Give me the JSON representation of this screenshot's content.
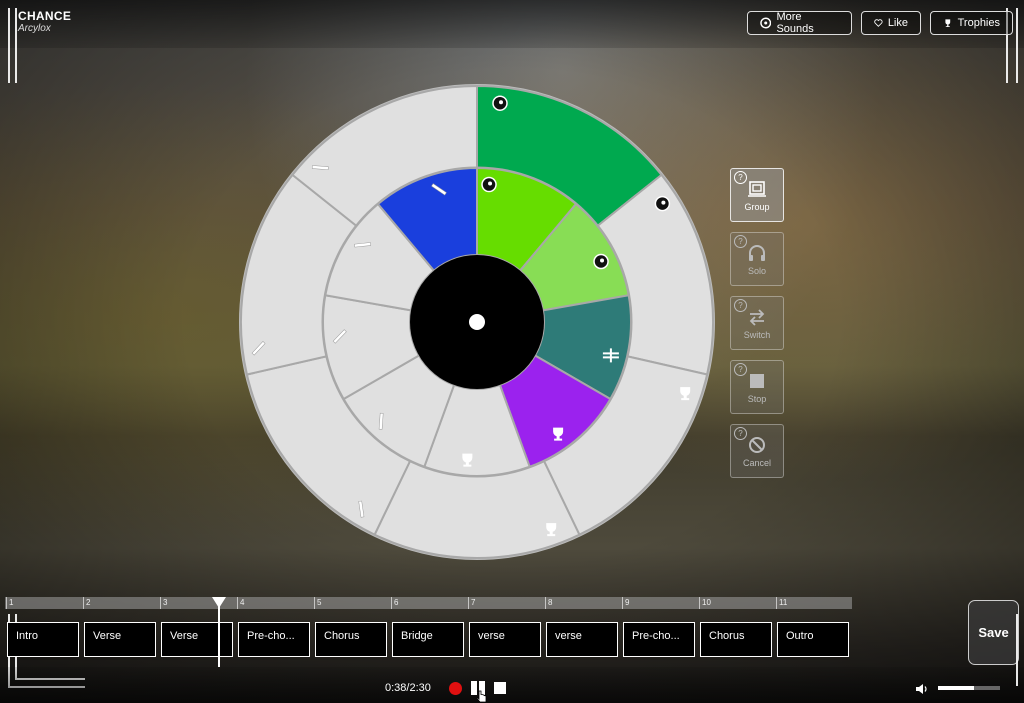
{
  "app": {
    "title": "CHANCE",
    "artist": "Arcylox"
  },
  "top_buttons": {
    "more_sounds": "More Sounds",
    "like": "Like",
    "trophies": "Trophies"
  },
  "side_buttons": [
    {
      "label": "Group",
      "icon": "group-icon",
      "active": true
    },
    {
      "label": "Solo",
      "icon": "headphones-icon",
      "active": false
    },
    {
      "label": "Switch",
      "icon": "switch-arrows-icon",
      "active": false
    },
    {
      "label": "Stop",
      "icon": "stop-square-icon",
      "active": false
    },
    {
      "label": "Cancel",
      "icon": "cancel-icon",
      "active": false
    }
  ],
  "wheel": {
    "outer_ring": [
      {
        "color": "#00a94f",
        "icon": "dot-icon",
        "active": true
      },
      {
        "color": "#e0e0e0",
        "icon": "dot-icon",
        "active": false
      },
      {
        "color": "#e0e0e0",
        "icon": "trophy-icon",
        "active": false
      },
      {
        "color": "#e0e0e0",
        "icon": "trophy-icon",
        "active": false
      },
      {
        "color": "#e0e0e0",
        "icon": "bar-icon",
        "active": false
      },
      {
        "color": "#e0e0e0",
        "icon": "bar-icon",
        "active": false
      },
      {
        "color": "#e0e0e0",
        "icon": "bar-icon",
        "active": false
      }
    ],
    "inner_ring": [
      {
        "color": "#66dd00",
        "icon": "dot-icon",
        "active": true
      },
      {
        "color": "#88dd55",
        "icon": "dot-icon",
        "active": true
      },
      {
        "color": "#2e7b78",
        "icon": "fork-icon",
        "active": true
      },
      {
        "color": "#9b22ee",
        "icon": "trophy-icon",
        "active": true
      },
      {
        "color": "#e0e0e0",
        "icon": "trophy-icon",
        "active": false
      },
      {
        "color": "#e0e0e0",
        "icon": "bar-icon",
        "active": false
      },
      {
        "color": "#e0e0e0",
        "icon": "bar-icon",
        "active": false
      },
      {
        "color": "#e0e0e0",
        "icon": "bar-icon",
        "active": false
      },
      {
        "color": "#1a3fdd",
        "icon": "bar-icon",
        "active": true
      }
    ]
  },
  "timeline": {
    "bars": [
      "1",
      "2",
      "3",
      "4",
      "5",
      "6",
      "7",
      "8",
      "9",
      "10",
      "11"
    ],
    "sections": [
      "Intro",
      "Verse",
      "Verse",
      "Pre-cho...",
      "Chorus",
      "Bridge",
      "verse",
      "verse",
      "Pre-cho...",
      "Chorus",
      "Outro"
    ],
    "progress": 0.2533
  },
  "transport": {
    "time": "0:38/2:30",
    "volume": 0.6
  },
  "save_label": "Save",
  "colors": {
    "record": "#e01010",
    "group_green": "#00a94f"
  }
}
